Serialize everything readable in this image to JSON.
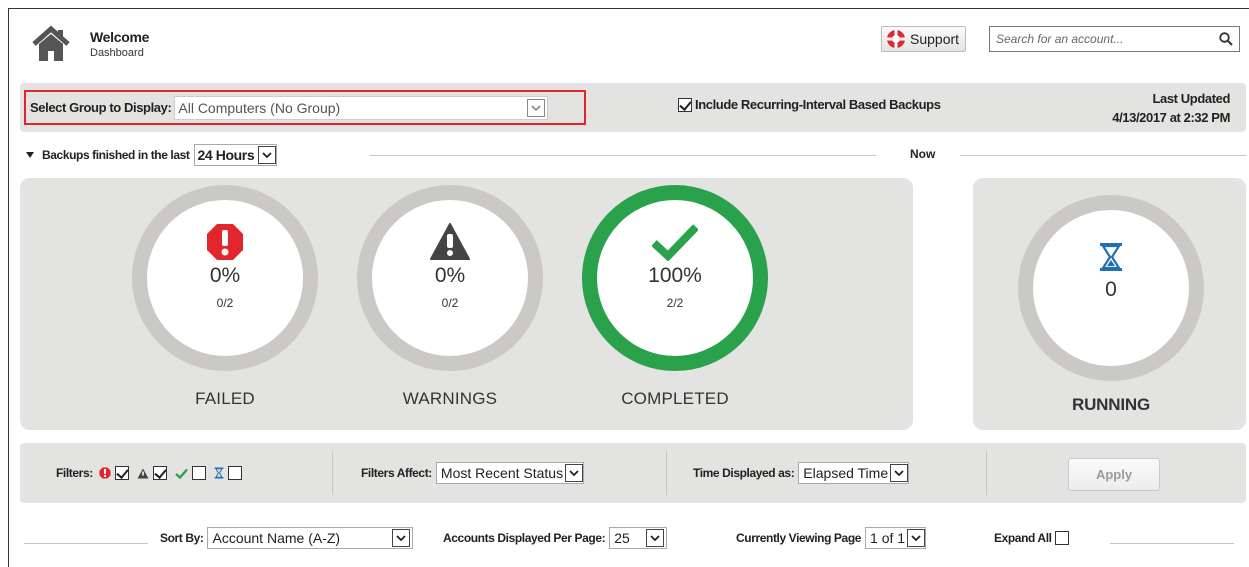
{
  "header": {
    "title": "Welcome",
    "subtitle": "Dashboard",
    "icon": "home-icon",
    "support_label": "Support",
    "search_placeholder": "Search for an account..."
  },
  "group_bar": {
    "label": "Select Group to Display:",
    "selected": "All Computers (No Group)",
    "include_recurring_label": "Include Recurring-Interval Based Backups",
    "include_recurring_checked": true,
    "last_updated_label": "Last Updated",
    "last_updated_value": "4/13/2017 at 2:32 PM",
    "highlight_color": "#e0262b"
  },
  "period": {
    "label": "Backups finished in the last",
    "selected": "24 Hours",
    "now_label": "Now"
  },
  "stats": [
    {
      "key": "failed",
      "pct": "0%",
      "fraction": "0/2",
      "title": "FAILED",
      "icon": "error-octagon-icon",
      "color": "#e2262b"
    },
    {
      "key": "warnings",
      "pct": "0%",
      "fraction": "0/2",
      "title": "WARNINGS",
      "icon": "warning-triangle-icon",
      "color": "#444444"
    },
    {
      "key": "completed",
      "pct": "100%",
      "fraction": "2/2",
      "title": "COMPLETED",
      "icon": "checkmark-icon",
      "color": "#29a24b"
    }
  ],
  "running": {
    "count": "0",
    "title": "RUNNING",
    "icon": "hourglass-icon",
    "color": "#1f6fb5"
  },
  "filters": {
    "label": "Filters:",
    "error_checked": true,
    "warning_checked": true,
    "completed_checked": false,
    "running_checked": false,
    "affect_label": "Filters Affect:",
    "affect_value": "Most Recent Status",
    "time_label": "Time Displayed as:",
    "time_value": "Elapsed Time",
    "apply_label": "Apply"
  },
  "sort": {
    "sort_label": "Sort By:",
    "sort_value": "Account Name (A-Z)",
    "per_page_label": "Accounts Displayed Per Page:",
    "per_page_value": "25",
    "page_label": "Currently Viewing Page",
    "page_value": "1 of 1",
    "expand_label": "Expand All",
    "expand_checked": false
  }
}
